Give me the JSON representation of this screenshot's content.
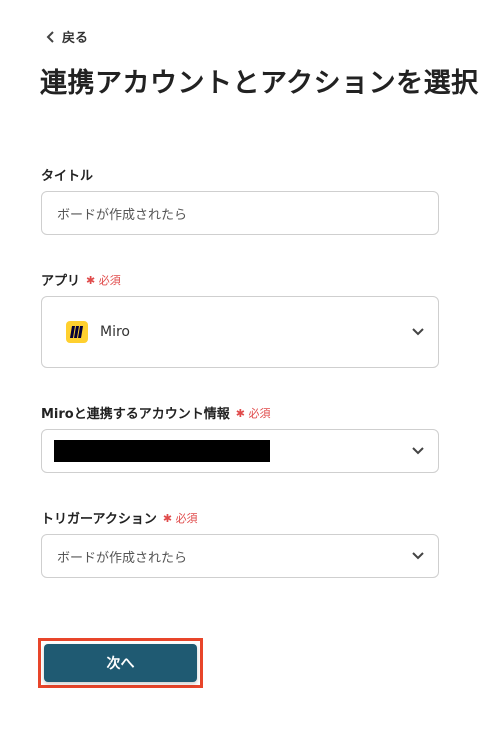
{
  "back": {
    "label": "戻る"
  },
  "page_title": "連携アカウントとアクションを選択",
  "fields": {
    "title": {
      "label": "タイトル",
      "value": "ボードが作成されたら"
    },
    "app": {
      "label": "アプリ",
      "required": "必須",
      "value": "Miro"
    },
    "account": {
      "label": "Miroと連携するアカウント情報",
      "required": "必須"
    },
    "trigger": {
      "label": "トリガーアクション",
      "required": "必須",
      "value": "ボードが作成されたら"
    }
  },
  "next_button": {
    "label": "次へ"
  },
  "colors": {
    "accent": "#1f5a72",
    "required": "#e04b4b",
    "highlight": "#e8452a",
    "miro": "#ffd02f"
  }
}
